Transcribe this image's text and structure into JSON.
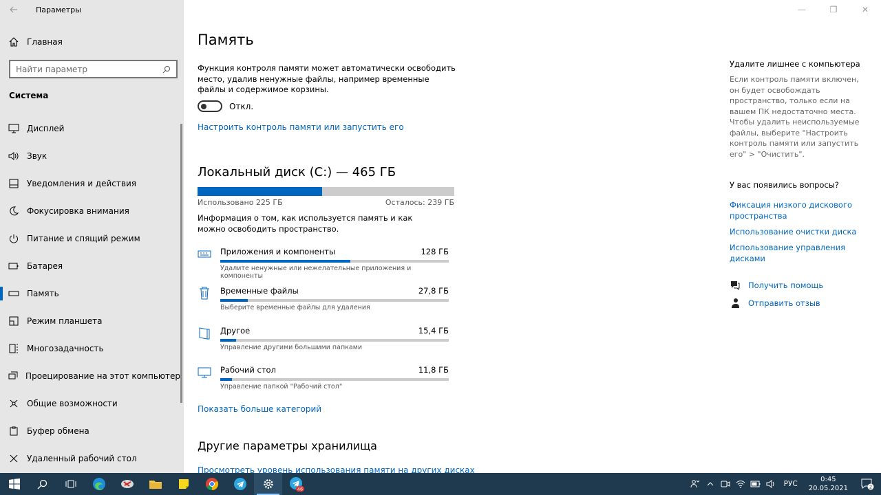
{
  "window": {
    "title": "Параметры",
    "controls": [
      "—",
      "❐",
      "✕"
    ]
  },
  "sidebar": {
    "home_label": "Главная",
    "search_placeholder": "Найти параметр",
    "section": "Система",
    "items": [
      {
        "label": "Дисплей",
        "icon": "display-icon"
      },
      {
        "label": "Звук",
        "icon": "sound-icon"
      },
      {
        "label": "Уведомления и действия",
        "icon": "notifications-icon"
      },
      {
        "label": "Фокусировка внимания",
        "icon": "focus-icon"
      },
      {
        "label": "Питание и спящий режим",
        "icon": "power-icon"
      },
      {
        "label": "Батарея",
        "icon": "battery-icon"
      },
      {
        "label": "Память",
        "icon": "storage-icon",
        "active": true
      },
      {
        "label": "Режим планшета",
        "icon": "tablet-icon"
      },
      {
        "label": "Многозадачность",
        "icon": "multitasking-icon"
      },
      {
        "label": "Проецирование на этот компьютер",
        "icon": "projecting-icon"
      },
      {
        "label": "Общие возможности",
        "icon": "shared-icon"
      },
      {
        "label": "Буфер обмена",
        "icon": "clipboard-icon"
      },
      {
        "label": "Удаленный рабочий стол",
        "icon": "remote-desktop-icon"
      }
    ]
  },
  "main": {
    "title": "Память",
    "intro": "Функция контроля памяти может автоматически освободить место, удалив ненужные файлы, например временные файлы и содержимое корзины.",
    "toggle_label": "Откл.",
    "toggle_on": false,
    "configure_link": "Настроить контроль памяти или запустить его",
    "disk": {
      "title": "Локальный диск (C:) — 465 ГБ",
      "used_label": "Использовано 225 ГБ",
      "free_label": "Осталось: 239 ГБ",
      "used_fraction": 0.485
    },
    "info": "Информация о том, как используется память и как можно освободить пространство.",
    "categories": [
      {
        "name": "Приложения и компоненты",
        "size": "128 ГБ",
        "sub": "Удалите ненужные или нежелательные приложения и компоненты",
        "fraction": 0.57,
        "icon": "apps-icon"
      },
      {
        "name": "Временные файлы",
        "size": "27,8 ГБ",
        "sub": "Выберите временные файлы для удаления",
        "fraction": 0.12,
        "icon": "trash-icon"
      },
      {
        "name": "Другое",
        "size": "15,4 ГБ",
        "sub": "Управление другими большими папками",
        "fraction": 0.07,
        "icon": "folder-other-icon"
      },
      {
        "name": "Рабочий стол",
        "size": "11,8 ГБ",
        "sub": "Управление папкой \"Рабочий стол\"",
        "fraction": 0.05,
        "icon": "desktop-icon"
      }
    ],
    "more_link": "Показать больше категорий",
    "other_title": "Другие параметры хранилища",
    "other_link": "Просмотреть уровень использования памяти на других дисках"
  },
  "right": {
    "heading1": "Удалите лишнее с компьютера",
    "para1": "Если контроль памяти включен, он будет освобождать пространство, только если на вашем ПК недостаточно места. Чтобы удалить неиспользуемые файлы, выберите \"Настроить контроль памяти или запустить его\" > \"Очистить\".",
    "heading2": "У вас появились вопросы?",
    "links": [
      "Фиксация низкого дискового пространства",
      "Использование очистки диска",
      "Использование управления дисками"
    ],
    "help": "Получить помощь",
    "feedback": "Отправить отзыв"
  },
  "taskbar": {
    "apps": [
      "start-icon",
      "search-icon",
      "task-view-icon",
      "edge-icon",
      "app-icon",
      "file-explorer-icon",
      "sticky-notes-icon",
      "chrome-icon",
      "telegram-icon",
      "settings-icon",
      "telegram-badge-icon"
    ],
    "badge": "46",
    "lang": "РУС",
    "time": "0:45",
    "date": "20.05.2021",
    "notifications": "2"
  }
}
